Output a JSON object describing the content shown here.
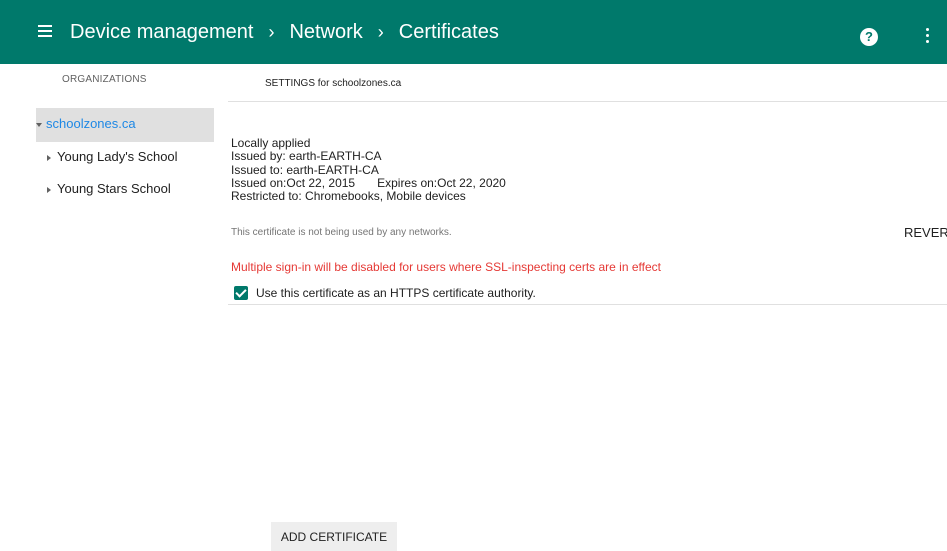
{
  "header": {
    "breadcrumbs": [
      "Device management",
      "Network",
      "Certificates"
    ],
    "separator": "›",
    "help_glyph": "?"
  },
  "sidebar": {
    "title": "ORGANIZATIONS",
    "root": "schoolzones.ca",
    "children": [
      "Young Lady's School",
      "Young Stars School"
    ]
  },
  "main": {
    "settings_title": "SETTINGS for schoolzones.ca",
    "cert": {
      "applied": "Locally applied",
      "issued_by": "Issued by: earth-EARTH-CA",
      "issued_to": "Issued to: earth-EARTH-CA",
      "issued_on": "Issued on:Oct 22, 2015",
      "expires_on": "Expires on:Oct 22, 2020",
      "restricted_to": "Restricted to: Chromebooks, Mobile devices"
    },
    "note": "This certificate is not being used by any networks.",
    "revert_label": "REVER",
    "warning": "Multiple sign-in will be disabled for users where SSL-inspecting certs are in effect",
    "checkbox_label": "Use this certificate as an HTTPS certificate authority.",
    "checkbox_checked": true,
    "add_button": "ADD CERTIFICATE"
  },
  "colors": {
    "header_bg": "#00796b",
    "link": "#1e88e5",
    "warning": "#e53935"
  },
  "icons": [
    "menu-icon",
    "help-icon",
    "more-vert-icon",
    "expand-down-icon",
    "expand-right-icon",
    "check-icon"
  ]
}
